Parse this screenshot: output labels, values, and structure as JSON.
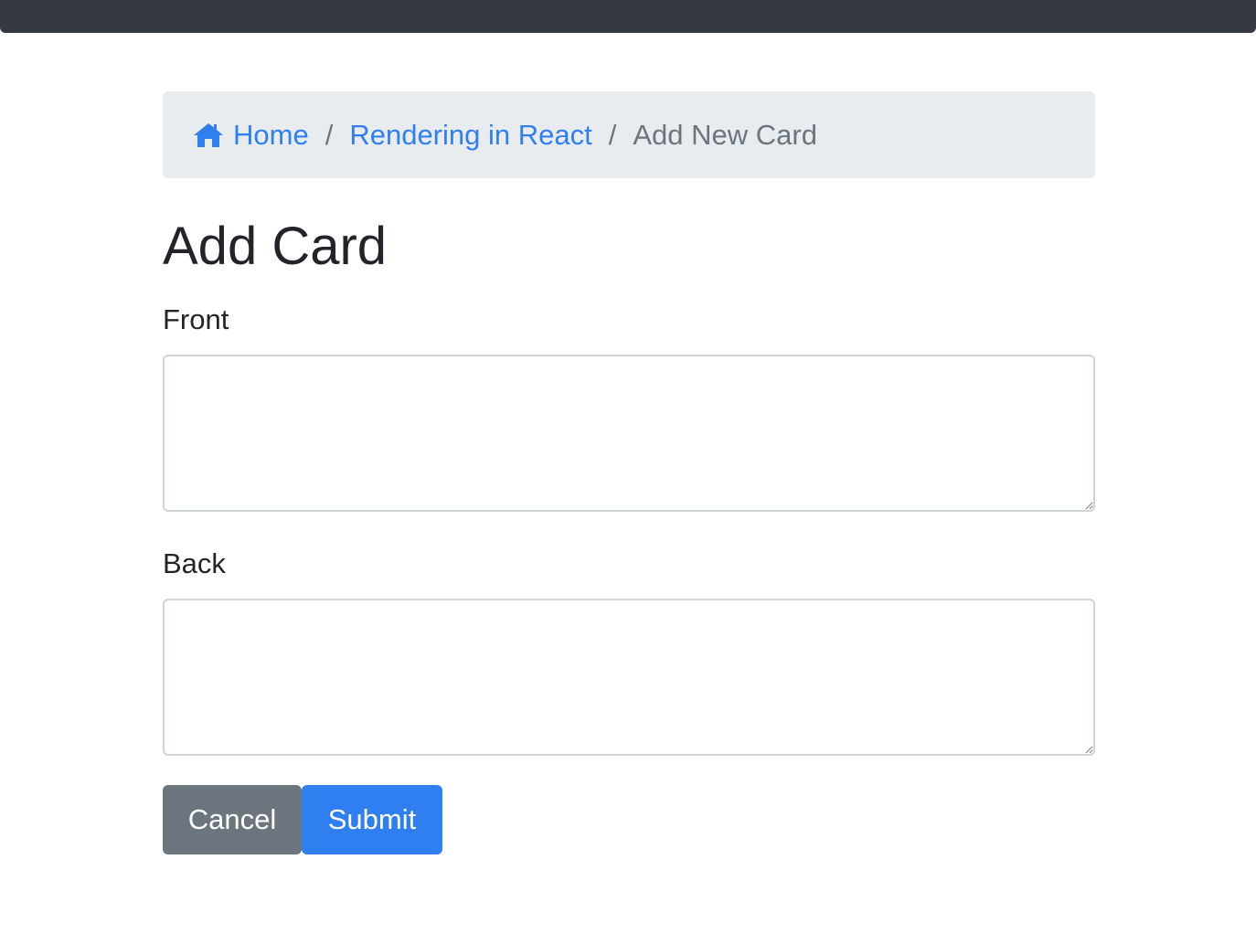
{
  "breadcrumb": {
    "home_icon": "home-icon",
    "home_label": "Home",
    "deck_label": "Rendering in React",
    "current_label": "Add New Card",
    "separator": "/"
  },
  "page": {
    "title": "Add Card"
  },
  "form": {
    "front_label": "Front",
    "front_value": "",
    "back_label": "Back",
    "back_value": "",
    "cancel_label": "Cancel",
    "submit_label": "Submit"
  },
  "colors": {
    "navbar": "#343a40",
    "breadcrumb_bg": "#e9ecef",
    "link": "#2f7ff0",
    "secondary": "#6c757d",
    "primary": "#2f7ff0"
  }
}
